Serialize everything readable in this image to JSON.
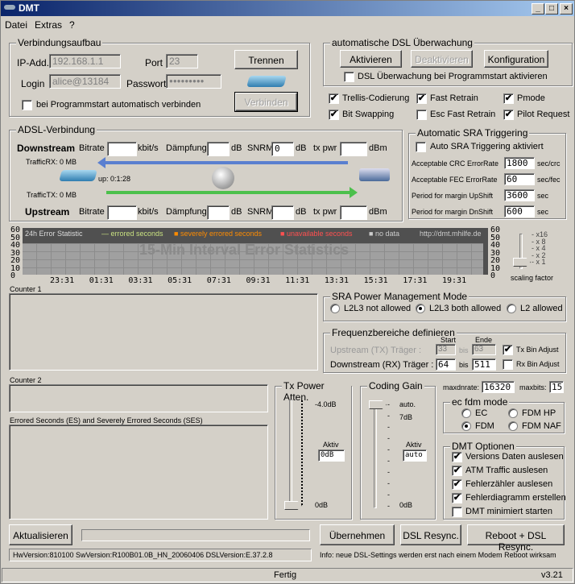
{
  "window": {
    "title": "DMT",
    "min": "_",
    "max": "□",
    "close": "×"
  },
  "menu": [
    "Datei",
    "Extras",
    "?"
  ],
  "conn": {
    "legend": "Verbindungsaufbau",
    "ip_label": "IP-Add.",
    "ip": "192.168.1.1",
    "port_label": "Port",
    "port": "23",
    "login_label": "Login",
    "login": "alice@13184",
    "pw_label": "Passwort",
    "pw": "●●●●●●●●●",
    "disconnect": "Trennen",
    "connect": "Verbinden",
    "autoconnect": "bei Programmstart automatisch verbinden"
  },
  "monitor": {
    "legend": "automatische DSL Überwachung",
    "activate": "Aktivieren",
    "deactivate": "Deaktivieren",
    "config": "Konfiguration",
    "autostart": "DSL Überwachung bei Programmstart aktivieren"
  },
  "opts": [
    {
      "label": "Trellis-Codierung",
      "checked": true
    },
    {
      "label": "Fast Retrain",
      "checked": true
    },
    {
      "label": "Pmode",
      "checked": true
    },
    {
      "label": "Bit Swapping",
      "checked": true
    },
    {
      "label": "Esc Fast Retrain",
      "checked": false
    },
    {
      "label": "Pilot Request",
      "checked": true
    }
  ],
  "adsl": {
    "legend": "ADSL-Verbindung",
    "down": "Downstream",
    "up": "Upstream",
    "bitrate": "Bitrate",
    "kbit": "kbit/s",
    "daempf": "Dämpfung",
    "db": "dB",
    "snrm": "SNRM",
    "txpwr": "tx pwr",
    "dbm": "dBm",
    "down_snrm": "0",
    "traffic_rx": "TrafficRX: 0 MB",
    "traffic_tx": "TrafficTX: 0 MB",
    "uptime": "up: 0:1:28"
  },
  "sra": {
    "legend": "Automatic SRA Triggering",
    "enable": "Auto SRA Triggering aktiviert",
    "rows": [
      {
        "label": "Acceptable CRC ErrorRate",
        "value": "1800",
        "unit": "sec/crc"
      },
      {
        "label": "Acceptable FEC ErrorRate",
        "value": "60",
        "unit": "sec/fec"
      },
      {
        "label": "Period for margin UpShift",
        "value": "3600",
        "unit": "sec"
      },
      {
        "label": "Period for margin DnShift",
        "value": "600",
        "unit": "sec"
      }
    ]
  },
  "chart_data": {
    "type": "bar",
    "title": "24h Error Statistic",
    "watermark": "15-Min Interval Error Statistics",
    "url": "http://dmt.mhilfe.de",
    "legend": [
      "errored seconds",
      "severely errored seconds",
      "unavailable seconds",
      "no data"
    ],
    "colors": {
      "es": "#c8e080",
      "ses": "#ff8c00",
      "uas": "#ff5050",
      "nodata": "#c0c0c0"
    },
    "yticks": [
      "60",
      "50",
      "40",
      "30",
      "20",
      "10",
      "0"
    ],
    "ylim": [
      0,
      60
    ],
    "xticks": [
      "23:31",
      "01:31",
      "03:31",
      "05:31",
      "07:31",
      "09:31",
      "11:31",
      "13:31",
      "15:31",
      "17:31",
      "19:31"
    ],
    "series": []
  },
  "scaling": {
    "labels": [
      "x16",
      "x 8",
      "x 4",
      "x 2",
      "x 1"
    ],
    "caption": "scaling factor",
    "value": "x 1"
  },
  "counter1": "Counter 1",
  "counter2": "Counter 2",
  "es_label": "Errored Seconds (ES) and Severely Errored Seconds (SES)",
  "power": {
    "legend": "SRA Power Management Mode",
    "options": [
      "L2L3 not allowed",
      "L2L3 both allowed",
      "L2 allowed"
    ],
    "selected": 1
  },
  "freq": {
    "legend": "Frequenzbereiche definieren",
    "start": "Start",
    "end": "Ende",
    "up_label": "Upstream (TX) Träger :",
    "up_start": "33",
    "up_end": "63",
    "down_label": "Downstream (RX) Träger :",
    "down_start": "64",
    "down_end": "511",
    "bis": "bis",
    "tx_adj": "Tx Bin Adjust",
    "rx_adj": "Rx Bin Adjust"
  },
  "txatt": {
    "legend": "Tx Power Atten.",
    "top": "-4.0dB",
    "bottom": "0dB",
    "aktiv": "Aktiv",
    "value": "0dB"
  },
  "cg": {
    "legend": "Coding Gain",
    "top": "auto.",
    "second": "7dB",
    "bottom": "0dB",
    "aktiv": "Aktiv",
    "value": "auto"
  },
  "maxdnrate_label": "maxdnrate:",
  "maxdnrate": "16320",
  "maxbits_label": "maxbits:",
  "maxbits": "15",
  "ecfdm": {
    "legend": "ec fdm mode",
    "options": [
      "EC",
      "FDM HP",
      "FDM",
      "FDM NAF"
    ],
    "selected": "FDM"
  },
  "dmtopt": {
    "legend": "DMT Optionen",
    "items": [
      {
        "label": "Versions Daten auslesen",
        "checked": true
      },
      {
        "label": "ATM Traffic auslesen",
        "checked": true
      },
      {
        "label": "Fehlerzähler auslesen",
        "checked": true
      },
      {
        "label": "Fehlerdiagramm erstellen",
        "checked": true
      },
      {
        "label": "DMT minimiert starten",
        "checked": false
      }
    ]
  },
  "bottom": {
    "refresh": "Aktualisieren",
    "apply": "Übernehmen",
    "resync": "DSL Resync.",
    "reboot": "Reboot + DSL Resync.",
    "version": "HwVersion:810100  SwVersion:R100B01.0B_HN_20060406  DSLVersion:E.37.2.8",
    "info": "Info: neue DSL-Settings werden erst nach einem Modem Reboot wirksam"
  },
  "status": {
    "text": "Fertig",
    "version": "v3.21"
  }
}
